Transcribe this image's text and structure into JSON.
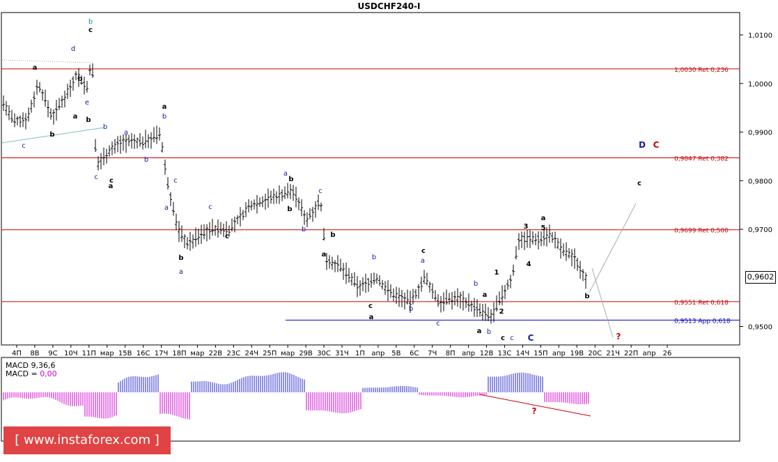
{
  "title": "USDCHF240-I",
  "chart_data": {
    "type": "line",
    "title": "USDCHF240-I",
    "price_axis": [
      "1,0100",
      "1,0000",
      "0,9900",
      "0,9800",
      "0,9700",
      "0,9500"
    ],
    "ylim": [
      0.9462,
      1.0146
    ],
    "current_price": "0,9602",
    "x_ticks": [
      "4П",
      "8В",
      "9С",
      "10Ч",
      "11П",
      "мар",
      "15В",
      "16С",
      "17Ч",
      "18П",
      "мар",
      "22В",
      "23С",
      "24Ч",
      "25П",
      "мар",
      "29В",
      "30С",
      "31Ч",
      "1П",
      "апр",
      "5В",
      "6С",
      "7Ч",
      "8П",
      "апр",
      "12В",
      "13С",
      "14Ч",
      "15П",
      "апр",
      "19В",
      "20С",
      "21Ч",
      "22П",
      "апр",
      "26"
    ],
    "levels": [
      {
        "label": "1,0030 Ret 0,236",
        "price": 1.003,
        "color": "#cc0000"
      },
      {
        "label": "0,9847 Ret 0,382",
        "price": 0.9847,
        "color": "#cc0000"
      },
      {
        "label": "0,9699 Ret 0,500",
        "price": 0.9699,
        "color": "#cc0000"
      },
      {
        "label": "0,9551 Ret 0,618",
        "price": 0.9551,
        "color": "#cc0000"
      },
      {
        "label": "0,9513 App 0,618",
        "price": 0.9513,
        "color": "#0000cc"
      }
    ],
    "macd": {
      "label": "MACD 9,36,6",
      "label2": "MACD = ",
      "value2": "0,00"
    },
    "wave_labels": [
      "b",
      "c",
      "d",
      "a",
      "b",
      "e",
      "b",
      "c",
      "b",
      "a",
      "c",
      "a",
      "b",
      "c",
      "a",
      "b",
      "a",
      "b",
      "c",
      "a",
      "b",
      "a",
      "c",
      "c",
      "a",
      "b",
      "b",
      "b",
      "c",
      "a",
      "b",
      "b",
      "c",
      "a",
      "c",
      "a",
      "b",
      "c",
      "b",
      "a",
      "a",
      "b",
      "1",
      "2",
      "c",
      "c",
      "C",
      "a",
      "3",
      "5",
      "4",
      "b",
      "D",
      "C",
      "c",
      "?",
      "?"
    ]
  },
  "watermark": "[ www.instaforex.com ]",
  "colors": {
    "candle": "#000000",
    "macd_pos": "#2222cc",
    "macd_neg": "#cc00cc",
    "ret": "#cc0000",
    "app": "#0000cc",
    "grid": "#000000"
  }
}
